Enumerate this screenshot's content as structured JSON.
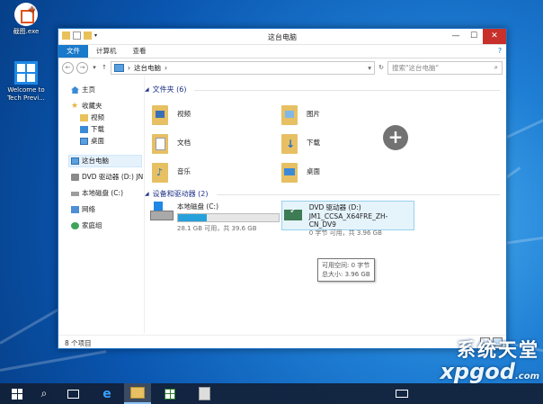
{
  "desktop": {
    "icons": [
      {
        "label": "截图.exe",
        "icon": "screenshot-app-icon"
      },
      {
        "label": "Welcome to Tech Previ...",
        "icon": "windows-logo-icon"
      }
    ],
    "add_overlay": "+"
  },
  "window": {
    "title": "这台电脑",
    "ribbon_tabs": [
      "文件",
      "计算机",
      "查看"
    ],
    "controls": {
      "minimize": "—",
      "maximize": "☐",
      "close": "✕"
    },
    "address": {
      "crumbs": [
        "这台电脑"
      ],
      "search_placeholder": "搜索\"这台电脑\""
    },
    "nav": {
      "items": [
        {
          "label": "主页",
          "icon": "home-icon"
        },
        {
          "label": "收藏夹",
          "icon": "star-icon"
        },
        {
          "label": "视频",
          "icon": "video-folder-icon"
        },
        {
          "label": "下载",
          "icon": "download-folder-icon"
        },
        {
          "label": "桌面",
          "icon": "desktop-folder-icon"
        },
        {
          "label": "这台电脑",
          "icon": "computer-icon"
        },
        {
          "label": "DVD 驱动器 (D:) JN",
          "icon": "dvd-icon"
        },
        {
          "label": "本地磁盘 (C:)",
          "icon": "disk-icon"
        },
        {
          "label": "网络",
          "icon": "network-icon"
        },
        {
          "label": "家庭组",
          "icon": "homegroup-icon"
        }
      ]
    },
    "folders_group": "文件夹 (6)",
    "folders": [
      {
        "label": "视频"
      },
      {
        "label": "图片"
      },
      {
        "label": "文档"
      },
      {
        "label": "下载"
      },
      {
        "label": "音乐"
      },
      {
        "label": "桌面"
      }
    ],
    "devices_group": "设备和驱动器 (2)",
    "drives": [
      {
        "name": "本地磁盘 (C:)",
        "detail": "28.1 GB 可用，共 39.6 GB",
        "used_fraction": 0.29
      },
      {
        "name": "DVD 驱动器 (D:)",
        "line2": "JM1_CCSA_X64FRE_ZH-CN_DV9",
        "detail": "0 字节 可用，共 3.96 GB"
      }
    ],
    "tooltip": {
      "line1": "可用空间: 0 字节",
      "line2": "总大小: 3.96 GB"
    },
    "status": "8 个项目"
  },
  "taskbar": {
    "items": [
      "start",
      "search",
      "task-view",
      "internet-explorer",
      "file-explorer",
      "store",
      "app"
    ]
  },
  "watermark": {
    "line1": "系统天堂",
    "line2": "xpgod",
    "line3": ".com"
  }
}
